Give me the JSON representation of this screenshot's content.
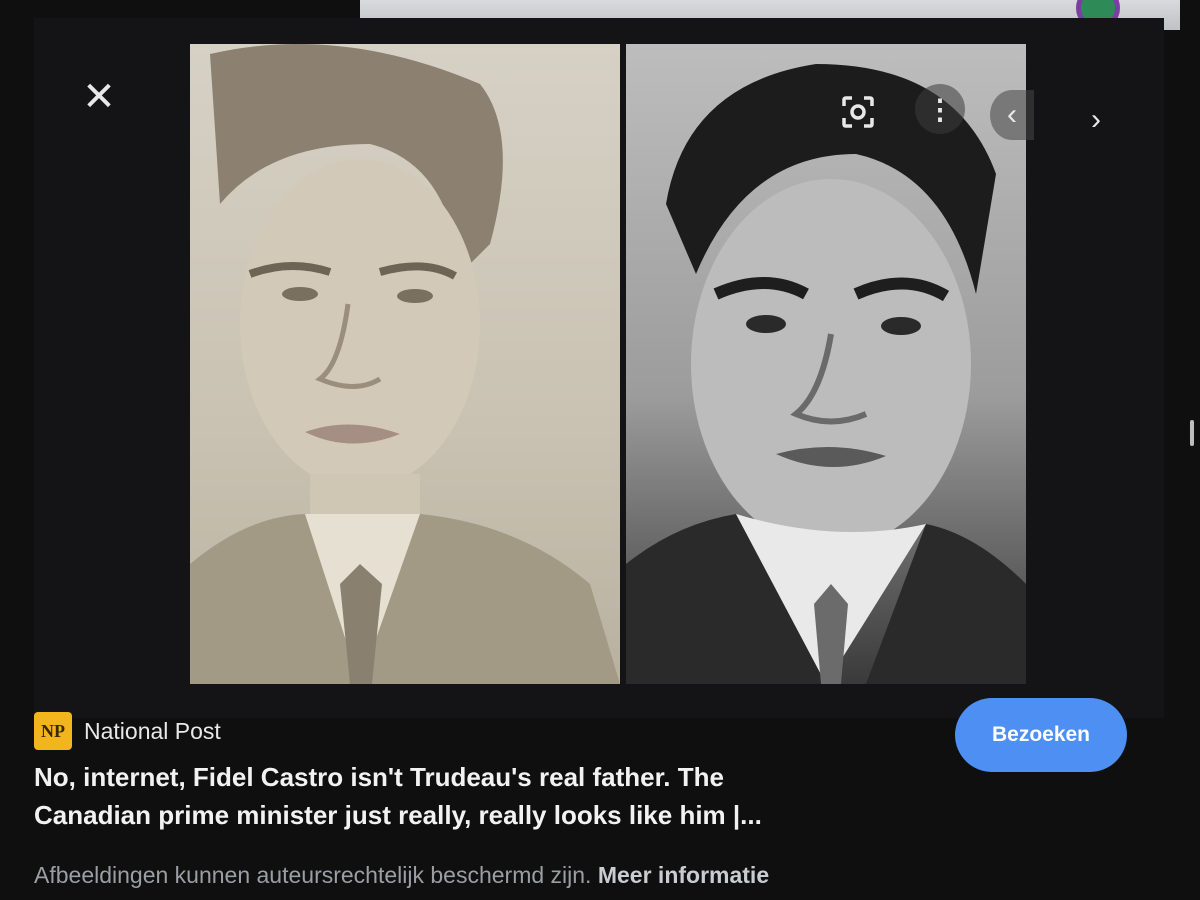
{
  "viewer": {
    "close_icon": "close-icon",
    "lens_icon": "google-lens-icon",
    "more_icon": "more-vert-icon",
    "prev_icon": "chevron-left-icon",
    "next_icon": "chevron-right-icon",
    "close_glyph": "✕",
    "more_glyph": "⋮",
    "prev_glyph": "‹",
    "next_glyph": "›"
  },
  "source": {
    "logo_text": "NP",
    "name": "National Post",
    "logo_color": "#f2b51d"
  },
  "actions": {
    "visit_label": "Bezoeken",
    "visit_color": "#4d8ff2"
  },
  "article": {
    "title_line1": "No, internet, Fidel Castro isn't Trudeau's real father. The",
    "title_line2": "Canadian prime minister just really, really looks like him |..."
  },
  "footer": {
    "copyright_text": "Afbeeldingen kunnen auteursrechtelijk beschermd zijn.",
    "more_info_label": "Meer informatie"
  }
}
